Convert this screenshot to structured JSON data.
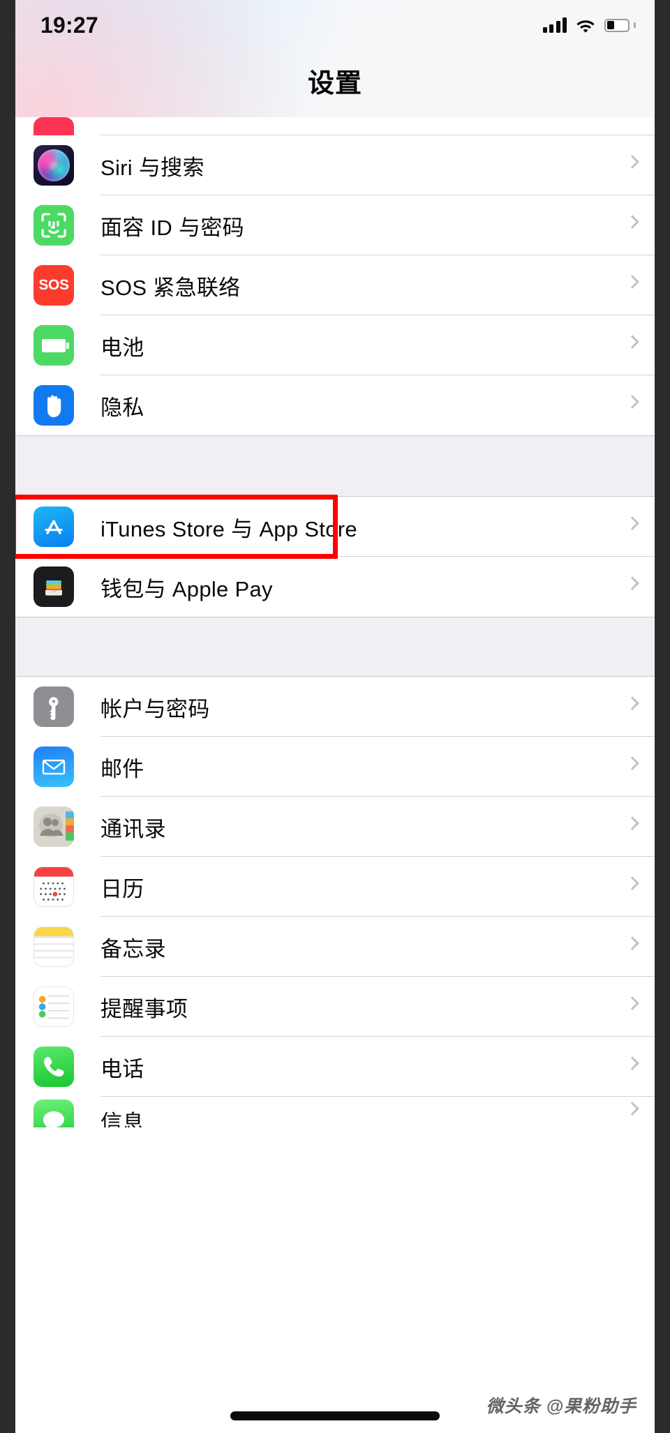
{
  "status_bar": {
    "time": "19:27",
    "signal_icon": "cellular-bars-icon",
    "signal_bars": 4,
    "wifi_icon": "wifi-icon",
    "battery_icon": "battery-icon",
    "battery_level_pct": 35
  },
  "header": {
    "title": "设置"
  },
  "groups": [
    {
      "rows": [
        {
          "label": "",
          "icon": "clipped-red-icon",
          "clipped": true
        },
        {
          "label": "Siri 与搜索",
          "icon": "siri-icon"
        },
        {
          "label": "面容 ID 与密码",
          "icon": "face-id-icon"
        },
        {
          "label": "SOS 紧急联络",
          "icon": "sos-icon",
          "icon_text": "SOS"
        },
        {
          "label": "电池",
          "icon": "battery-settings-icon"
        },
        {
          "label": "隐私",
          "icon": "privacy-hand-icon"
        }
      ]
    },
    {
      "rows": [
        {
          "label": "iTunes Store 与 App Store",
          "icon": "app-store-icon",
          "highlighted": true
        },
        {
          "label": "钱包与 Apple Pay",
          "icon": "wallet-icon"
        }
      ]
    },
    {
      "rows": [
        {
          "label": "帐户与密码",
          "icon": "key-icon"
        },
        {
          "label": "邮件",
          "icon": "mail-icon"
        },
        {
          "label": "通讯录",
          "icon": "contacts-icon"
        },
        {
          "label": "日历",
          "icon": "calendar-icon"
        },
        {
          "label": "备忘录",
          "icon": "notes-icon"
        },
        {
          "label": "提醒事项",
          "icon": "reminders-icon"
        },
        {
          "label": "电话",
          "icon": "phone-icon"
        },
        {
          "label": "信息",
          "icon": "messages-icon",
          "clipped": true
        }
      ]
    }
  ],
  "disclosure_icon": "chevron-right-icon",
  "highlight": {
    "color": "#ff0000",
    "target": "iTunes Store 与 App Store"
  },
  "home_indicator": "home-indicator",
  "watermark": "微头条 @果粉助手",
  "colors": {
    "highlight_red": "#ff0000",
    "group_background": "#efeff4",
    "row_background": "#ffffff",
    "separator": "#d3d3d6",
    "chevron": "#c2c2c6"
  }
}
